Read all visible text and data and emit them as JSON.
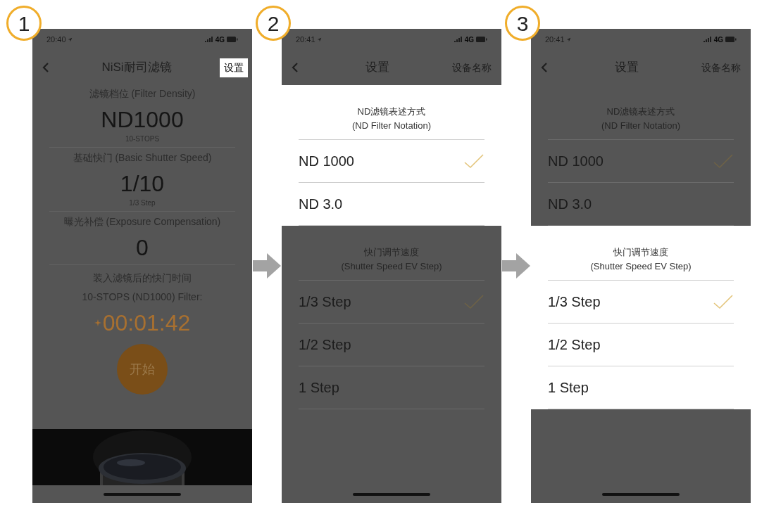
{
  "steps": [
    {
      "badge": "1",
      "kind": "main",
      "status": {
        "time": "20:40",
        "network": "4G"
      },
      "nav": {
        "title": "NiSi耐司滤镜",
        "action": "设置",
        "action_highlighted": true
      },
      "sections": [
        {
          "label": "滤镜档位 (Filter Density)",
          "value": "ND1000",
          "sub": "10-STOPS"
        },
        {
          "label": "基础快门 (Basic Shutter Speed)",
          "value": "1/10",
          "sub": "1/3 Step"
        },
        {
          "label": "曝光补偿 (Exposure Compensation)",
          "value": "0"
        }
      ],
      "result": {
        "lines": [
          "装入滤镜后的快门时间",
          "10-STOPS (ND1000) Filter:"
        ],
        "time": "00:01:42"
      },
      "start_button": "开始"
    },
    {
      "badge": "2",
      "kind": "settings",
      "status": {
        "time": "20:41",
        "network": "4G"
      },
      "nav": {
        "title": "设置",
        "action": "设备名称",
        "action_highlighted": false
      },
      "groups": [
        {
          "title": "ND滤镜表述方式",
          "subtitle": "(ND Filter Notation)",
          "highlighted": true,
          "options": [
            {
              "label": "ND 1000",
              "selected": true
            },
            {
              "label": "ND 3.0",
              "selected": false
            }
          ]
        },
        {
          "title": "快门调节速度",
          "subtitle": "(Shutter Speed EV Step)",
          "highlighted": false,
          "options": [
            {
              "label": "1/3 Step",
              "selected": true
            },
            {
              "label": "1/2 Step",
              "selected": false
            },
            {
              "label": "1 Step",
              "selected": false
            }
          ]
        }
      ]
    },
    {
      "badge": "3",
      "kind": "settings",
      "status": {
        "time": "20:41",
        "network": "4G"
      },
      "nav": {
        "title": "设置",
        "action": "设备名称",
        "action_highlighted": false
      },
      "groups": [
        {
          "title": "ND滤镜表述方式",
          "subtitle": "(ND Filter Notation)",
          "highlighted": false,
          "options": [
            {
              "label": "ND 1000",
              "selected": true
            },
            {
              "label": "ND 3.0",
              "selected": false
            }
          ]
        },
        {
          "title": "快门调节速度",
          "subtitle": "(Shutter Speed EV Step)",
          "highlighted": true,
          "options": [
            {
              "label": "1/3 Step",
              "selected": true
            },
            {
              "label": "1/2 Step",
              "selected": false
            },
            {
              "label": "1 Step",
              "selected": false
            }
          ]
        }
      ]
    }
  ]
}
